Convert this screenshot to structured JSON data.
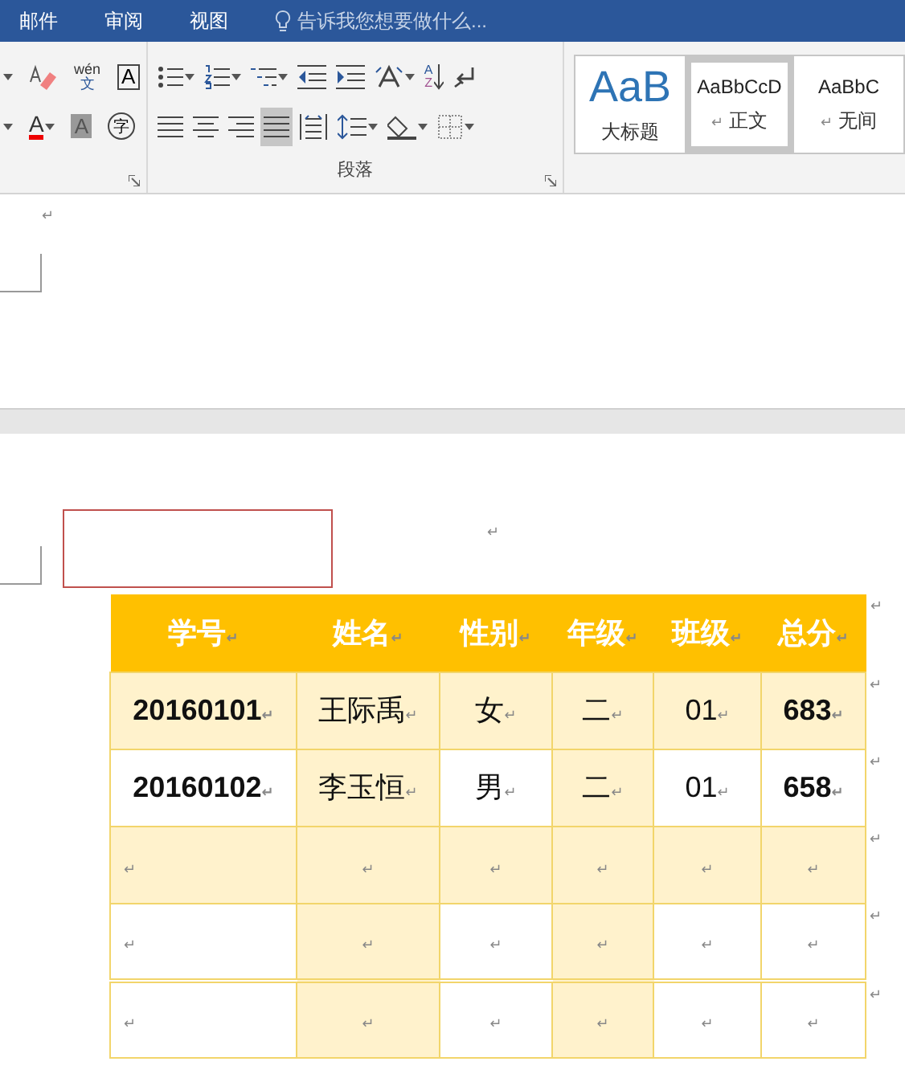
{
  "tabs": [
    {
      "label": "邮件"
    },
    {
      "label": "审阅"
    },
    {
      "label": "视图"
    }
  ],
  "tell_me": {
    "placeholder": "告诉我您想要做什么..."
  },
  "font_group": {
    "row1": [
      {
        "kind": "dropdown"
      },
      {
        "kind": "eraser"
      },
      {
        "kind": "phonetic",
        "glyph": "wén",
        "glyph2": "文"
      },
      {
        "kind": "boxed",
        "glyph": "A"
      }
    ],
    "row2": [
      {
        "kind": "dropdown"
      },
      {
        "kind": "fontcolor",
        "glyph": "A"
      },
      {
        "kind": "shaded",
        "glyph": "A"
      },
      {
        "kind": "circled",
        "glyph": "字"
      }
    ]
  },
  "paragraph_group": {
    "label": "段落",
    "row1": [
      {
        "kind": "bullets"
      },
      {
        "kind": "numbering"
      },
      {
        "kind": "multilevel"
      },
      {
        "kind": "outdent"
      },
      {
        "kind": "indent"
      },
      {
        "kind": "textdir"
      },
      {
        "kind": "sort",
        "glyph": "A",
        "glyph2": "Z"
      },
      {
        "kind": "marks",
        "selected": false
      }
    ],
    "row2": [
      {
        "kind": "left",
        "selected": false
      },
      {
        "kind": "center",
        "selected": false
      },
      {
        "kind": "right",
        "selected": false
      },
      {
        "kind": "justify",
        "selected": true
      },
      {
        "kind": "distribute",
        "selected": false
      },
      {
        "kind": "spacing"
      },
      {
        "kind": "fill"
      },
      {
        "kind": "borders"
      }
    ]
  },
  "styles": [
    {
      "sample": "AaB",
      "name": "大标题",
      "selected": false,
      "kind": "heading"
    },
    {
      "sample": "AaBbCcD",
      "name": "正文",
      "mark": "↵",
      "selected": true,
      "kind": "normal"
    },
    {
      "sample": "AaBbC",
      "name": "无间",
      "mark": "↵",
      "selected": false,
      "kind": "normal"
    }
  ],
  "page1": {
    "mark": "↵"
  },
  "table": {
    "header": [
      {
        "text": "学号",
        "end": "↵"
      },
      {
        "text": "姓名",
        "end": "↵"
      },
      {
        "text": "性别",
        "end": "↵"
      },
      {
        "text": "年级",
        "end": "↵"
      },
      {
        "text": "班级",
        "end": "↵"
      },
      {
        "text": "总分",
        "end": "↵"
      }
    ],
    "header_row_end": "↵",
    "rows": [
      {
        "end": "↵",
        "cells": [
          {
            "text": "20160101",
            "end": "↵",
            "bold": true,
            "shaded": true
          },
          {
            "text": "王际禹",
            "end": "↵",
            "bold": false,
            "shaded": true
          },
          {
            "text": "女",
            "end": "↵",
            "bold": false,
            "shaded": true
          },
          {
            "text": "二",
            "end": "↵",
            "bold": false,
            "shaded": true
          },
          {
            "text": "01",
            "end": "↵",
            "bold": false,
            "shaded": true
          },
          {
            "text": "683",
            "end": "↵",
            "bold": true,
            "shaded": true
          }
        ]
      },
      {
        "end": "↵",
        "cells": [
          {
            "text": "20160102",
            "end": "↵",
            "bold": true,
            "shaded": false
          },
          {
            "text": "李玉恒",
            "end": "↵",
            "bold": false,
            "shaded": true
          },
          {
            "text": "男",
            "end": "↵",
            "bold": false,
            "shaded": false
          },
          {
            "text": "二",
            "end": "↵",
            "bold": false,
            "shaded": true
          },
          {
            "text": "01",
            "end": "↵",
            "bold": false,
            "shaded": false
          },
          {
            "text": "658",
            "end": "↵",
            "bold": true,
            "shaded": false
          }
        ]
      },
      {
        "end": "↵",
        "cells": [
          {
            "end": "↵",
            "shaded": true
          },
          {
            "end": "↵",
            "shaded": true
          },
          {
            "end": "↵",
            "shaded": true
          },
          {
            "end": "↵",
            "shaded": true
          },
          {
            "end": "↵",
            "shaded": true
          },
          {
            "end": "↵",
            "shaded": true
          }
        ]
      },
      {
        "end": "↵",
        "cells": [
          {
            "end": "↵",
            "shaded": false
          },
          {
            "end": "↵",
            "shaded": true
          },
          {
            "end": "↵",
            "shaded": false
          },
          {
            "end": "↵",
            "shaded": true
          },
          {
            "end": "↵",
            "shaded": false
          },
          {
            "end": "↵",
            "shaded": false
          }
        ]
      },
      {
        "end": "↵",
        "cells": [
          {
            "end": "↵",
            "shaded": false
          },
          {
            "end": "↵",
            "shaded": true
          },
          {
            "end": "↵",
            "shaded": false
          },
          {
            "end": "↵",
            "shaded": true
          },
          {
            "end": "↵",
            "shaded": false
          },
          {
            "end": "↵",
            "shaded": false
          }
        ]
      }
    ]
  },
  "page2": {
    "mark": "↵"
  }
}
